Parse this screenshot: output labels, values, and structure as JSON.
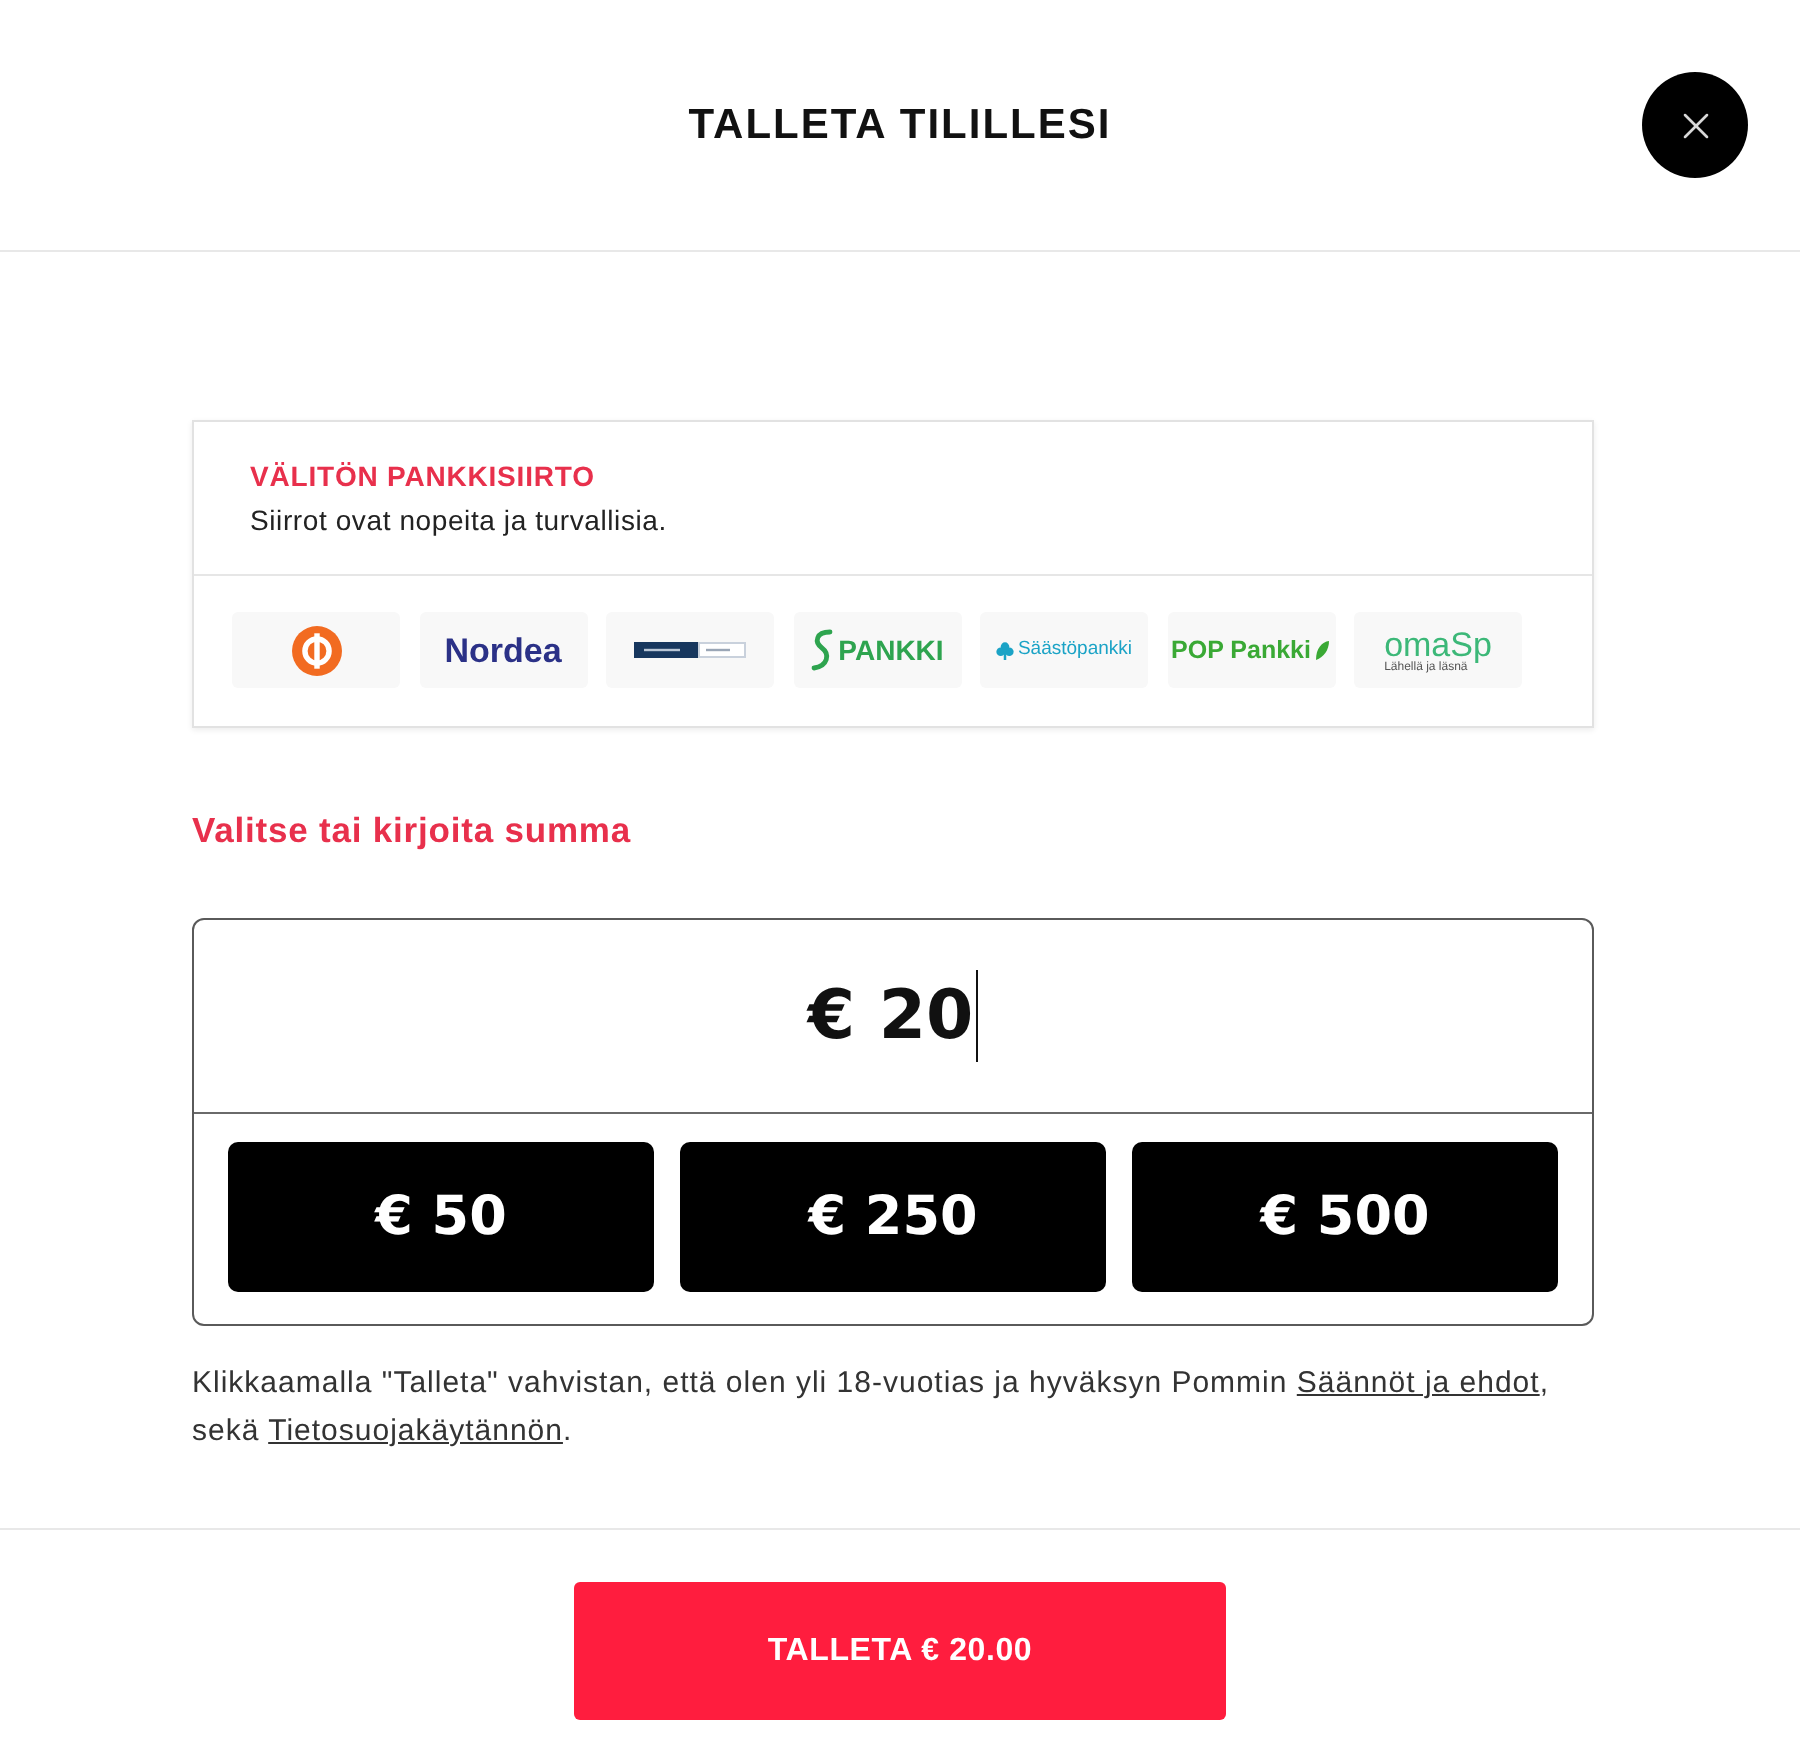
{
  "header": {
    "title": "TALLETA TILILLESI"
  },
  "payment_method": {
    "title": "VÄLITÖN PANKKISIIRTO",
    "subtitle": "Siirrot ovat nopeita ja turvallisia.",
    "banks": [
      {
        "kind": "ring-symbol",
        "color": "#f26b21"
      },
      {
        "kind": "wordmark",
        "name": "Nordea",
        "color": "#2b3187"
      },
      {
        "kind": "bar",
        "color": "#17375e"
      },
      {
        "kind": "swoosh-wordmark",
        "name": "PANKKI",
        "color": "#2ea44f"
      },
      {
        "kind": "flower-wordmark",
        "name": "Säästöpankki",
        "color": "#1ba3c6"
      },
      {
        "kind": "leaf-wordmark",
        "name": "POP Pankki",
        "color": "#3aa935"
      },
      {
        "kind": "tagline-wordmark",
        "name": "omaSp",
        "tagline": "Lähellä ja läsnä",
        "color": "#3cb878"
      }
    ]
  },
  "amount": {
    "heading": "Valitse tai kirjoita summa",
    "value": "€ 20",
    "focused": true,
    "quick_amounts": [
      "€ 50",
      "€ 250",
      "€ 500"
    ]
  },
  "disclaimer": {
    "text_before": "Klikkaamalla \"Talleta\" vahvistan, että olen yli 18-vuotias ja hyväksyn Pommin ",
    "link_1": "Säännöt ja ehdot",
    "text_middle": ", sekä ",
    "link_2": "Tietosuojakäytännön",
    "text_after": "."
  },
  "submit_button": {
    "label": "TALLETA € 20.00"
  }
}
